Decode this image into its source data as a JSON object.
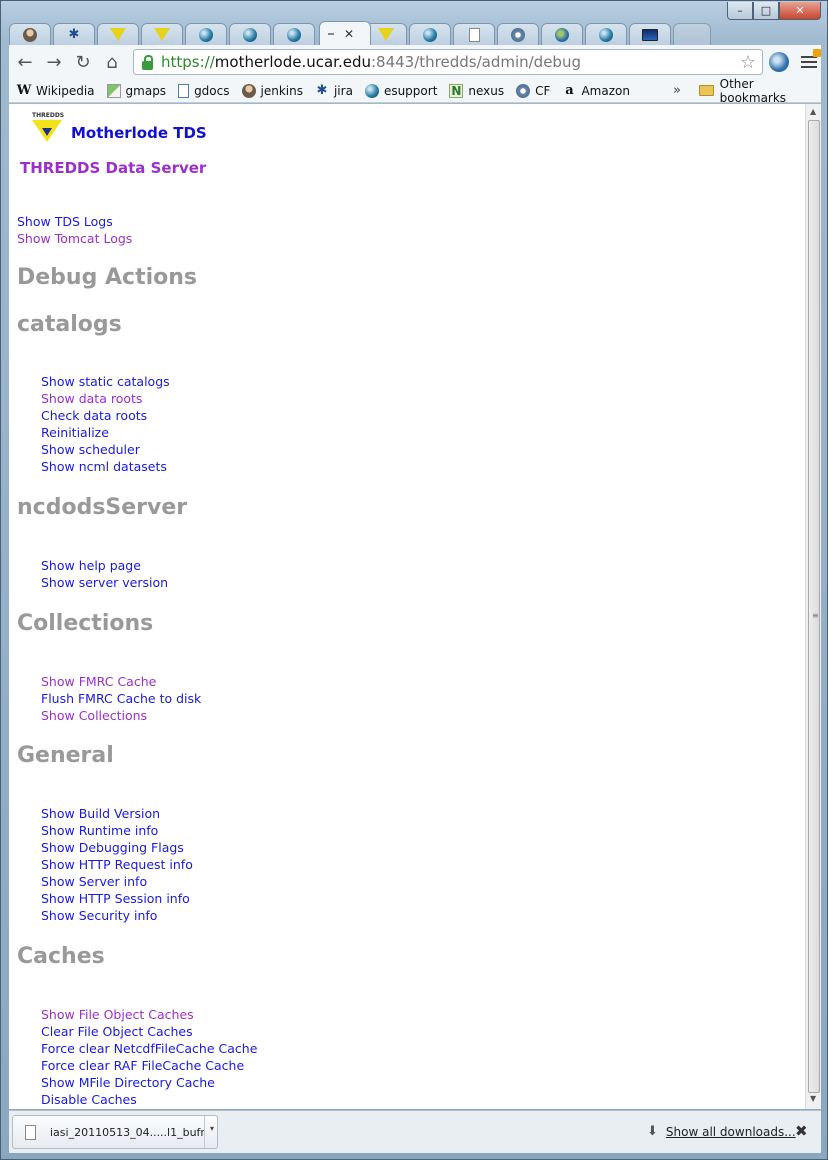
{
  "window": {
    "minimize_glyph": "–",
    "maximize_glyph": "□",
    "close_glyph": "✕"
  },
  "tabs": [
    {
      "icon": "person-icon"
    },
    {
      "icon": "jira-icon"
    },
    {
      "icon": "thredds-icon"
    },
    {
      "icon": "thredds-icon"
    },
    {
      "icon": "globe-icon"
    },
    {
      "icon": "globe-icon"
    },
    {
      "icon": "globe-icon"
    },
    {
      "icon": "active",
      "close": "✕"
    },
    {
      "icon": "thredds-icon"
    },
    {
      "icon": "globe-icon"
    },
    {
      "icon": "page-icon"
    },
    {
      "icon": "gear-icon"
    },
    {
      "icon": "earth-icon"
    },
    {
      "icon": "globe-icon"
    },
    {
      "icon": "screen-icon"
    }
  ],
  "toolbar": {
    "back": "←",
    "forward": "→",
    "reload": "↻",
    "home": "⌂",
    "url_scheme": "https://",
    "url_host": "motherlode.ucar.edu",
    "url_path": ":8443/thredds/admin/debug",
    "star": "☆"
  },
  "bookmarks": {
    "items": [
      {
        "label": "Wikipedia",
        "icon": "W"
      },
      {
        "label": "gmaps",
        "icon": ""
      },
      {
        "label": "gdocs",
        "icon": ""
      },
      {
        "label": "jenkins",
        "icon": ""
      },
      {
        "label": "jira",
        "icon": "✱"
      },
      {
        "label": "esupport",
        "icon": ""
      },
      {
        "label": "nexus",
        "icon": "N"
      },
      {
        "label": "CF",
        "icon": ""
      },
      {
        "label": "Amazon",
        "icon": "a"
      }
    ],
    "more": "»",
    "other": "Other bookmarks"
  },
  "page": {
    "logo_text": "THREDDS",
    "site_title": "Motherlode TDS",
    "subtitle": "THREDDS Data Server",
    "top_links": [
      "Show TDS Logs",
      "Show Tomcat Logs"
    ],
    "debug_heading": "Debug Actions",
    "sections": [
      {
        "title": "catalogs",
        "links": [
          "Show static catalogs",
          "Show data roots",
          "Check data roots",
          "Reinitialize",
          "Show scheduler",
          "Show ncml datasets"
        ]
      },
      {
        "title": "ncdodsServer",
        "links": [
          "Show help page",
          "Show server version"
        ]
      },
      {
        "title": "Collections",
        "links": [
          "Show FMRC Cache",
          "Flush FMRC Cache to disk",
          "Show Collections"
        ]
      },
      {
        "title": "General",
        "links": [
          "Show Build Version",
          "Show Runtime info",
          "Show Debugging Flags",
          "Show HTTP Request info",
          "Show Server info",
          "Show HTTP Session info",
          "Show Security info"
        ]
      },
      {
        "title": "Caches",
        "links": [
          "Show File Object Caches",
          "Clear File Object Caches",
          "Force clear NetcdfFileCache Cache",
          "Force clear RAF FileCache Cache",
          "Show MFile Directory Cache",
          "Disable Caches"
        ]
      }
    ]
  },
  "downloads": {
    "file": "iasi_20110513_04.....l1_bufr",
    "caret": "▾",
    "show_all": "Show all downloads...",
    "arrow": "⬇",
    "close": "✖"
  },
  "scrollbar": {
    "up": "▲",
    "down": "▼",
    "grip": "≡"
  },
  "colors": {
    "link": "#1a1adb",
    "visited": "#9b30c8",
    "heading": "#999999",
    "site_title": "#1010d0"
  }
}
